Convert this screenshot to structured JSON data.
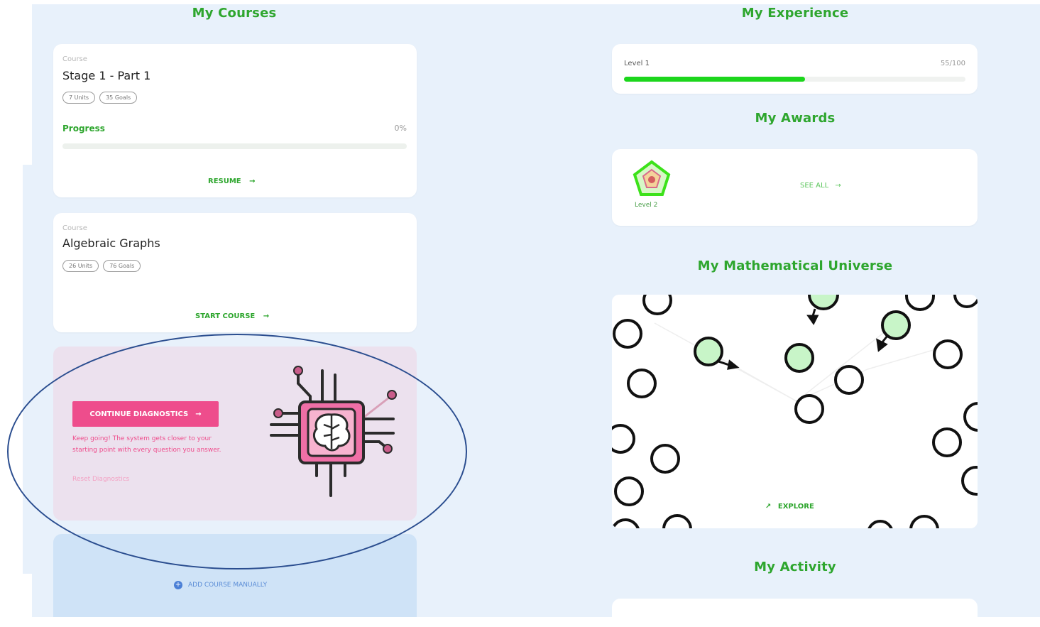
{
  "courses": {
    "title": "My Courses",
    "items": [
      {
        "label": "Course",
        "name": "Stage 1 - Part 1",
        "chips": [
          "7 Units",
          "35 Goals"
        ],
        "progress_label": "Progress",
        "progress_pct": "0%",
        "progress": 0.0,
        "action": "RESUME"
      },
      {
        "label": "Course",
        "name": "Algebraic Graphs",
        "chips": [
          "26 Units",
          "76 Goals"
        ],
        "action": "START COURSE"
      }
    ],
    "diagnostics": {
      "button_label": "CONTINUE DIAGNOSTICS",
      "message": "Keep going! The system gets closer to your starting point with every question you answer.",
      "reset_label": "Reset Diagnostics"
    },
    "add_course_label": "ADD COURSE MANUALLY"
  },
  "experience": {
    "title": "My Experience",
    "level": "Level 1",
    "value": "55/100",
    "progress": 0.53
  },
  "awards": {
    "title": "My Awards",
    "items": [
      {
        "name": "Level 2"
      }
    ],
    "see_all_label": "SEE ALL"
  },
  "universe": {
    "title": "My Mathematical Universe",
    "explore_label": "EXPLORE"
  },
  "activity": {
    "title": "My Activity"
  },
  "colors": {
    "accent": "#2ea62e",
    "progress": "#1cd61c",
    "diagnostic": "#ee4d8c",
    "node_fill": "#c8f5c8"
  }
}
